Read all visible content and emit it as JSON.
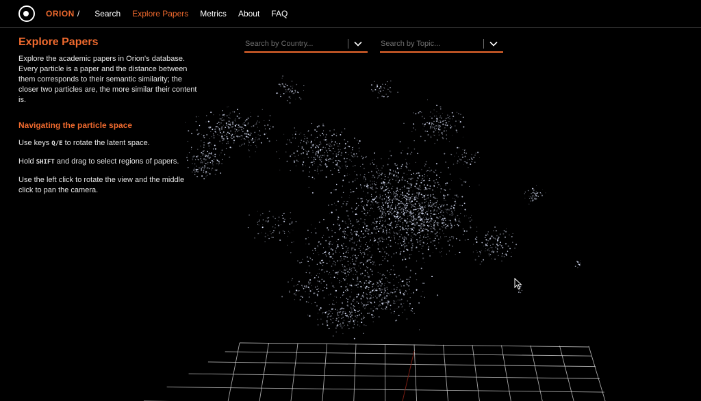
{
  "nav": {
    "brand": "ORION",
    "slash": "/",
    "links": [
      {
        "label": "Search",
        "active": false
      },
      {
        "label": "Explore Papers",
        "active": true
      },
      {
        "label": "Metrics",
        "active": false
      },
      {
        "label": "About",
        "active": false
      },
      {
        "label": "FAQ",
        "active": false
      }
    ]
  },
  "panel": {
    "title": "Explore Papers",
    "description": "Explore the academic papers in Orion's database. Every particle is a paper and the distance between them corresponds to their semantic similarity; the closer two particles are, the more similar their content is.",
    "subtitle": "Navigating the particle space",
    "tip_rotate_pre": "Use keys ",
    "tip_rotate_keys": "Q/E",
    "tip_rotate_post": " to rotate the latent space.",
    "tip_select_pre": "Hold ",
    "tip_select_key": "SHIFT",
    "tip_select_post": " and drag to select regions of papers.",
    "tip_mouse": "Use the left click to rotate the view and the middle click to pan the camera."
  },
  "filters": {
    "country_placeholder": "Search by Country...",
    "topic_placeholder": "Search by Topic..."
  },
  "icons": {
    "logo": "orion-logo-icon",
    "dropdown": "chevron-down-icon",
    "cursor": "mouse-pointer-icon"
  },
  "colors": {
    "accent": "#f06a2e",
    "background": "#000000",
    "text": "#e8e8e8",
    "muted": "#6f6f6f",
    "particle": "#dfe6ff",
    "grid": "#e0e0e0"
  }
}
